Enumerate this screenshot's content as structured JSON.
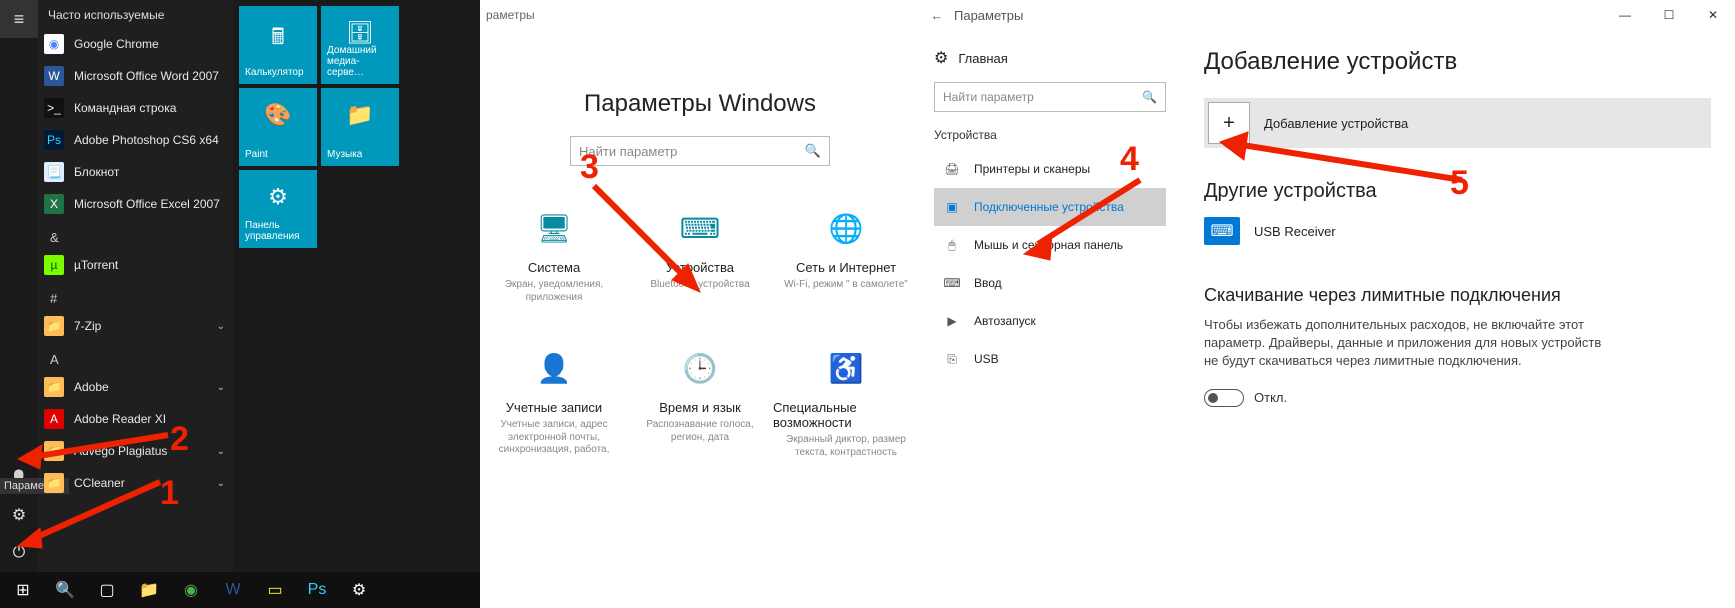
{
  "callouts": {
    "c1": "1",
    "c2": "2",
    "c3": "3",
    "c4": "4",
    "c5": "5"
  },
  "start": {
    "section_most": "Часто используемые",
    "apps_most": [
      {
        "name": "Google Chrome",
        "color": "#fff",
        "fg": "#4285f4",
        "glyph": "◉"
      },
      {
        "name": "Microsoft Office Word 2007",
        "color": "#2b579a",
        "fg": "#fff",
        "glyph": "W"
      },
      {
        "name": "Командная строка",
        "color": "#111",
        "fg": "#fff",
        "glyph": ">_"
      },
      {
        "name": "Adobe Photoshop CS6 x64",
        "color": "#001b33",
        "fg": "#3cf",
        "glyph": "Ps"
      },
      {
        "name": "Блокнот",
        "color": "#ddeeff",
        "fg": "#336",
        "glyph": "📃"
      },
      {
        "name": "Microsoft Office Excel 2007",
        "color": "#217346",
        "fg": "#fff",
        "glyph": "X"
      }
    ],
    "letterAmp": "&",
    "apps_amp": [
      {
        "name": "µTorrent",
        "color": "#7cfc00",
        "fg": "#006400",
        "glyph": "µ"
      }
    ],
    "letterHash": "#",
    "apps_hash": [
      {
        "name": "7-Zip",
        "color": "#ffbd59",
        "fg": "#000",
        "glyph": "📁",
        "expandable": true
      }
    ],
    "letterA": "A",
    "apps_a": [
      {
        "name": "Adobe",
        "color": "#ffbd59",
        "fg": "#000",
        "glyph": "📁",
        "expandable": true
      },
      {
        "name": "Adobe Reader XI",
        "color": "#d00",
        "fg": "#fff",
        "glyph": "A"
      },
      {
        "name": "Advego Plagiatus",
        "color": "#ffbd59",
        "fg": "#000",
        "glyph": "📁",
        "expandable": true
      },
      {
        "name": "CCleaner",
        "color": "#ffbd59",
        "fg": "#000",
        "glyph": "📁",
        "expandable": true
      }
    ],
    "tooltip_settings": "Параметры",
    "tiles": [
      {
        "label": "Калькулятор",
        "glyph": "🖩"
      },
      {
        "label": "Домашний медиа-серве…",
        "glyph": "🗄"
      },
      {
        "label": "Paint",
        "glyph": "🎨"
      },
      {
        "label": "Музыка",
        "glyph": "📁"
      },
      {
        "label": "Панель управления",
        "glyph": "⚙"
      }
    ]
  },
  "shome": {
    "title_small": "раметры",
    "title": "Параметры Windows",
    "search_ph": "Найти параметр",
    "cats": [
      {
        "title": "Система",
        "sub": "Экран, уведомления, приложения",
        "glyph": "🖥"
      },
      {
        "title": "Устройства",
        "sub": "Bluetooth, устройства",
        "glyph": "⌨"
      },
      {
        "title": "Сеть и Интернет",
        "sub": "Wi-Fi, режим \" в самолете\"",
        "glyph": "🌐"
      },
      {
        "title": "Учетные записи",
        "sub": "Учетные записи, адрес электронной почты, синхронизация, работа,",
        "glyph": "👤"
      },
      {
        "title": "Время и язык",
        "sub": "Распознавание голоса, регион, дата",
        "glyph": "🕒"
      },
      {
        "title": "Специальные возможности",
        "sub": "Экранный диктор, размер текста, контрастность",
        "glyph": "♿"
      }
    ]
  },
  "dev": {
    "wtitle": "Параметры",
    "home": "Главная",
    "search_ph": "Найти параметр",
    "side_head": "Устройства",
    "side_items": [
      {
        "label": "Принтеры и сканеры",
        "glyph": "🖨"
      },
      {
        "label": "Подключенные устройства",
        "glyph": "▣",
        "active": true
      },
      {
        "label": "Мышь и сенсорная панель",
        "glyph": "🖱"
      },
      {
        "label": "Ввод",
        "glyph": "⌨"
      },
      {
        "label": "Автозапуск",
        "glyph": "▶"
      },
      {
        "label": "USB",
        "glyph": "⎘"
      }
    ],
    "h1": "Добавление устройств",
    "add": "Добавление устройства",
    "h2": "Другие устройства",
    "device": "USB Receiver",
    "h3": "Скачивание через лимитные подключения",
    "p": "Чтобы избежать дополнительных расходов, не включайте этот параметр. Драйверы, данные и приложения для новых устройств не будут скачиваться через лимитные подключения.",
    "toggle_off": "Откл."
  }
}
